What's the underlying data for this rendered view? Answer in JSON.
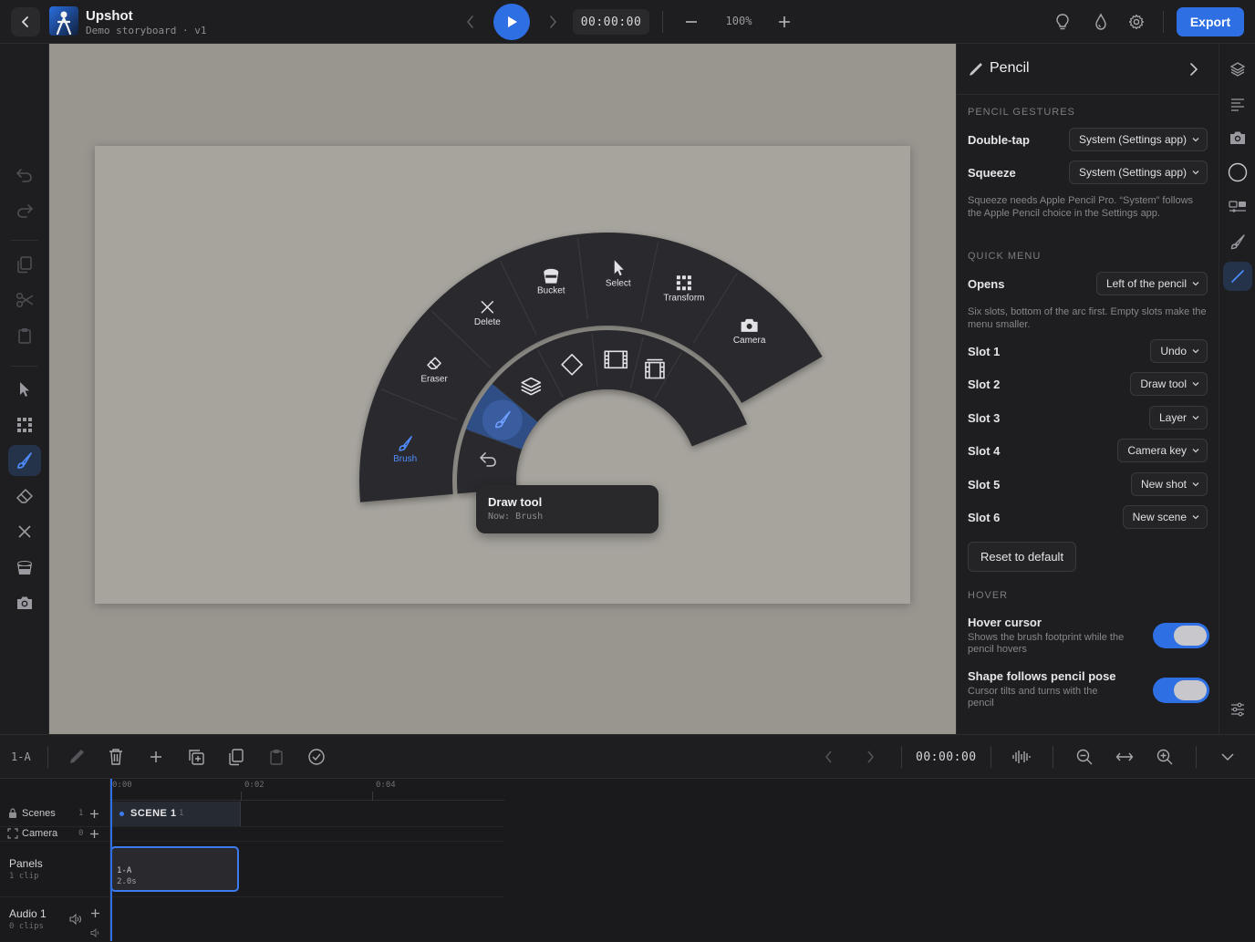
{
  "header": {
    "app_title": "Upshot",
    "app_subtitle": "Demo storyboard · v1",
    "timecode": "00:00:00",
    "zoom_level": "100%",
    "export_label": "Export"
  },
  "tools": {
    "labels": {
      "brush": "Brush",
      "eraser": "Eraser",
      "delete": "Delete",
      "bucket": "Bucket",
      "select": "Select",
      "transform": "Transform",
      "camera": "Camera"
    }
  },
  "tooltip": {
    "title": "Draw tool",
    "subtitle": "Now: Brush"
  },
  "panel": {
    "title": "Pencil",
    "gestures_section": "PENCIL GESTURES",
    "double_tap_label": "Double-tap",
    "double_tap_value": "System (Settings app)",
    "squeeze_label": "Squeeze",
    "squeeze_value": "System (Settings app)",
    "squeeze_note": "Squeeze needs Apple Pencil Pro. “System” follows the Apple Pencil choice in the Settings app.",
    "quick_menu_section": "QUICK MENU",
    "opens_label": "Opens",
    "opens_value": "Left of the pencil",
    "slots_note": "Six slots, bottom of the arc first. Empty slots make the menu smaller.",
    "slots": [
      {
        "label": "Slot 1",
        "value": "Undo"
      },
      {
        "label": "Slot 2",
        "value": "Draw tool"
      },
      {
        "label": "Slot 3",
        "value": "Layer"
      },
      {
        "label": "Slot 4",
        "value": "Camera key"
      },
      {
        "label": "Slot 5",
        "value": "New shot"
      },
      {
        "label": "Slot 6",
        "value": "New scene"
      }
    ],
    "reset_label": "Reset to default",
    "hover_section": "HOVER",
    "hover_cursor_label": "Hover cursor",
    "hover_cursor_desc": "Shows the brush footprint while the pencil hovers",
    "hover_cursor_on": true,
    "shape_follows_label": "Shape follows pencil pose",
    "shape_follows_desc": "Cursor tilts and turns with the pencil",
    "shape_follows_on": true
  },
  "bottom_toolbar": {
    "shot_label": "1-A",
    "timecode": "00:00:00"
  },
  "timeline": {
    "ticks": [
      "0:00",
      "0:02",
      "0:04"
    ],
    "tracks": {
      "scenes_label": "Scenes",
      "scenes_count": "1",
      "camera_label": "Camera",
      "camera_count": "0",
      "panels_label": "Panels",
      "panels_sub": "1 clip",
      "audio_label": "Audio 1",
      "audio_sub": "0 clips"
    },
    "scene_block": {
      "label": "SCENE 1",
      "count": "1"
    },
    "clip": {
      "name": "1-A",
      "duration": "2.0s"
    }
  },
  "colors": {
    "accent": "#2f6fe4",
    "canvas": "#99958f",
    "frame": "#a7a49e",
    "menu": "#2b2b2e"
  }
}
